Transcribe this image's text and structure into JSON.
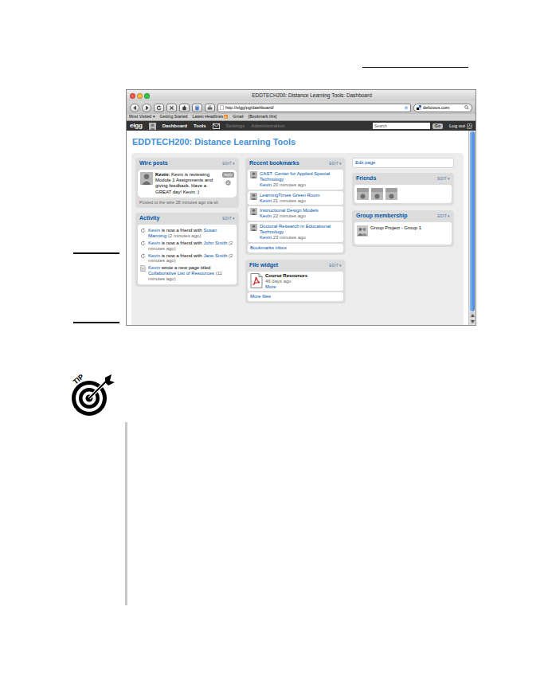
{
  "window": {
    "title": "EDDTECH200: Distance Learning Tools: Dashboard"
  },
  "toolbar": {
    "url": "http://elgg/pg/dashboard/",
    "search": "delicious.com"
  },
  "bookmarks_bar": [
    {
      "label": "Most Visited ▾",
      "kind": "link"
    },
    {
      "label": "Getting Started",
      "kind": "link"
    },
    {
      "label": "Latest Headlines",
      "kind": "feed"
    },
    {
      "label": "Gmail",
      "kind": "link"
    },
    {
      "label": "[Bookmark this]",
      "kind": "link"
    }
  ],
  "sitebar": {
    "logo": "elgg",
    "nav_main": [
      {
        "label": "Dashboard",
        "disabled": false
      },
      {
        "label": "Tools",
        "disabled": false
      }
    ],
    "nav_admin": [
      {
        "label": "Settings",
        "disabled": true
      },
      {
        "label": "Administration",
        "disabled": true
      }
    ],
    "search": "Search",
    "go": "Go",
    "logout": "Log out"
  },
  "page_title": "EDDTECH200: Distance Learning Tools",
  "columns": [
    [
      {
        "kind": "wire",
        "title": "Wire posts",
        "edit": "EDIT ▾",
        "post": {
          "author": "Kevin:",
          "text": "Kevin is reviewing Module 1 Assignments and giving feedback. Have a GREAT day! Kevin :)",
          "reply": "reply",
          "meta": "Posted to the wire 28 minutes ago via sit"
        }
      },
      {
        "kind": "activity",
        "title": "Activity",
        "edit": "EDIT ▾",
        "items": [
          {
            "kind": "friend",
            "actor": "Kevin",
            "text": "is now a friend with",
            "object": "Susan Manning",
            "time": "(2 minutes ago)"
          },
          {
            "kind": "friend",
            "actor": "Kevin",
            "text": "is now a friend with",
            "object": "John Smith",
            "time": "(2 minutes ago)"
          },
          {
            "kind": "friend",
            "actor": "Kevin",
            "text": "is now a friend with",
            "object": "Jane Smith",
            "time": "(2 minutes ago)"
          },
          {
            "kind": "page",
            "actor": "Kevin",
            "text": "wrote a new page titled",
            "object": "Collaborative List of Resources",
            "time": "(11 minutes ago)"
          }
        ]
      }
    ],
    [
      {
        "kind": "bookmarks",
        "title": "Recent bookmarks",
        "edit": "EDIT ▾",
        "items": [
          {
            "title": "CAST: Center for Applied Special Technology",
            "author": "Kevin",
            "time": "20 minutes ago"
          },
          {
            "title": "LearningTimes Green Room",
            "author": "Kevin",
            "time": "21 minutes ago"
          },
          {
            "title": "Instructional Design Models",
            "author": "Kevin",
            "time": "22 minutes ago"
          },
          {
            "title": "Doctoral Research in Educational Technology",
            "author": "Kevin",
            "time": "23 minutes ago"
          }
        ],
        "footer": "Bookmarks inbox"
      },
      {
        "kind": "files",
        "title": "File widget",
        "edit": "EDIT ▾",
        "items": [
          {
            "title": "Course Resources",
            "time": "46 days ago",
            "more": "More"
          }
        ],
        "footer": "More files"
      }
    ],
    [
      {
        "kind": "link",
        "label": "Edit page"
      },
      {
        "kind": "friends",
        "title": "Friends",
        "edit": "EDIT ▾",
        "avatars": 3
      },
      {
        "kind": "groups",
        "title": "Group membership",
        "edit": "EDIT ▾",
        "items": [
          {
            "name": "Group Project - Group 1"
          }
        ]
      }
    ]
  ],
  "tip": {
    "label": "TIP"
  }
}
